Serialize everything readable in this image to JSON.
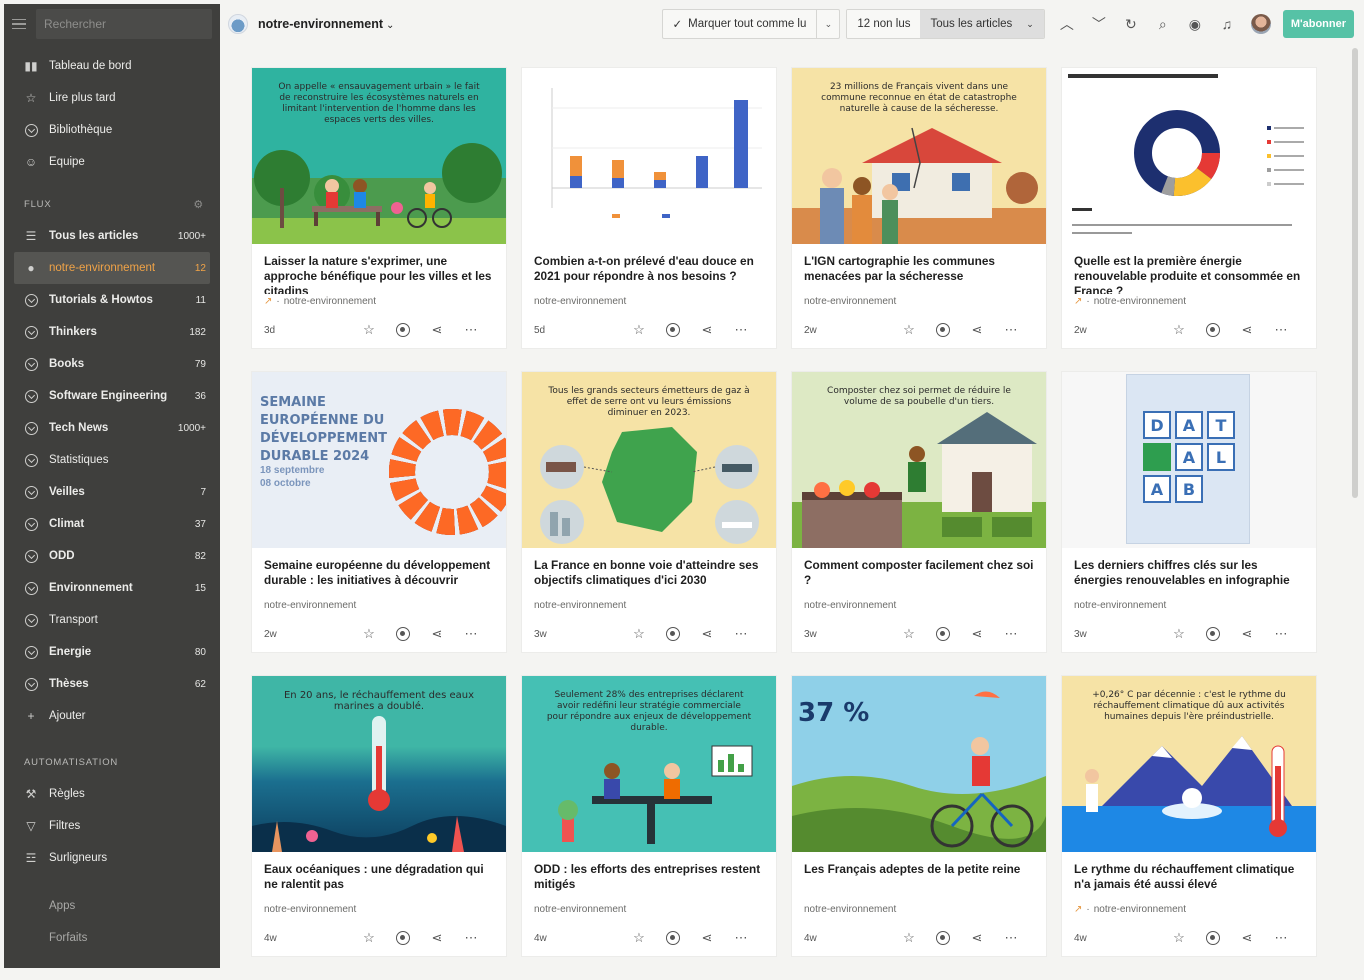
{
  "sidebar": {
    "search_placeholder": "Rechercher",
    "top_items": [
      {
        "label": "Tableau de bord",
        "icon": "bar-chart-icon"
      },
      {
        "label": "Lire plus tard",
        "icon": "star-icon"
      },
      {
        "label": "Bibliothèque",
        "icon": "check-circle-icon"
      },
      {
        "label": "Équipe",
        "icon": "team-icon"
      }
    ],
    "flux_title": "FLUX",
    "feeds": [
      {
        "label": "Tous les articles",
        "count": "1000+"
      },
      {
        "label": "notre-environnement",
        "count": "12"
      },
      {
        "label": "Tutorials & Howtos",
        "count": "11"
      },
      {
        "label": "Thinkers",
        "count": "182"
      },
      {
        "label": "Books",
        "count": "79"
      },
      {
        "label": "Software Engineering",
        "count": "36"
      },
      {
        "label": "Tech News",
        "count": "1000+"
      },
      {
        "label": "Statistiques",
        "count": ""
      },
      {
        "label": "Veilles",
        "count": "7"
      },
      {
        "label": "Climat",
        "count": "37"
      },
      {
        "label": "ODD",
        "count": "82"
      },
      {
        "label": "Environnement",
        "count": "15"
      },
      {
        "label": "Transport",
        "count": ""
      },
      {
        "label": "Energie",
        "count": "80"
      },
      {
        "label": "Thèses",
        "count": "62"
      },
      {
        "label": "Ajouter",
        "count": ""
      }
    ],
    "automation_title": "AUTOMATISATION",
    "automation": [
      {
        "label": "Règles"
      },
      {
        "label": "Filtres"
      },
      {
        "label": "Surligneurs"
      }
    ],
    "footer": [
      {
        "label": "Apps"
      },
      {
        "label": "Forfaits"
      }
    ]
  },
  "header": {
    "feed_name": "notre-environnement",
    "mark_all": "Marquer tout comme lu",
    "unread": "12 non lus",
    "filter": "Tous les articles",
    "subscribe": "M'abonner"
  },
  "thumb_texts": [
    "On appelle « ensauvagement urbain » le fait de reconstruire les écosystèmes naturels en limitant l'intervention de l'homme dans les espaces verts des villes.",
    "",
    "23 millions de Français vivent dans une commune reconnue en état de catastrophe naturelle à cause de la sécheresse.",
    "",
    "SEMAINE EUROPÉENNE DU DÉVELOPPEMENT DURABLE 2024",
    "Tous les grands secteurs émetteurs de gaz à effet de serre ont vu leurs émissions diminuer en 2023.",
    "Composter chez soi permet de réduire le volume de sa poubelle d'un tiers.",
    "",
    "En 20 ans, le réchauffement des eaux marines a doublé.",
    "Seulement 28% des entreprises déclarent avoir redéfini leur stratégie commerciale pour répondre aux enjeux de développement durable.",
    "37 %",
    "+0,26° C par décennie : c'est le rythme du réchauffement climatique dû aux activités humaines depuis l'ère préindustrielle."
  ],
  "sedd": {
    "dates1": "18 septembre",
    "dates2": "08 octobre"
  },
  "data_letters": [
    "D",
    "A",
    "T",
    "A",
    "L",
    "A",
    "B"
  ],
  "cards": [
    {
      "title": "Laisser la nature s'exprimer, une approche bénéfique pour les villes et les citadins",
      "source": "notre-environnement",
      "trend": true,
      "age": "3d"
    },
    {
      "title": "Combien a-t-on prélevé d'eau douce en 2021 pour répondre à nos besoins ?",
      "source": "notre-environnement",
      "trend": false,
      "age": "5d"
    },
    {
      "title": "L'IGN cartographie les communes menacées par la sécheresse",
      "source": "notre-environnement",
      "trend": false,
      "age": "2w"
    },
    {
      "title": "Quelle est la première énergie renouvelable produite et consommée en France ?",
      "source": "notre-environnement",
      "trend": true,
      "age": "2w"
    },
    {
      "title": "Semaine européenne du développement durable : les initiatives à découvrir",
      "source": "notre-environnement",
      "trend": false,
      "age": "2w"
    },
    {
      "title": "La France en bonne voie d'atteindre ses objectifs climatiques d'ici 2030",
      "source": "notre-environnement",
      "trend": false,
      "age": "3w"
    },
    {
      "title": "Comment composter facilement chez soi ?",
      "source": "notre-environnement",
      "trend": false,
      "age": "3w"
    },
    {
      "title": "Les derniers chiffres clés sur les énergies renouvelables en infographie",
      "source": "notre-environnement",
      "trend": false,
      "age": "3w"
    },
    {
      "title": "Eaux océaniques : une dégradation qui ne ralentit pas",
      "source": "notre-environnement",
      "trend": false,
      "age": "4w"
    },
    {
      "title": "ODD : les efforts des entreprises restent mitigés",
      "source": "notre-environnement",
      "trend": false,
      "age": "4w"
    },
    {
      "title": "Les Français adeptes de la petite reine",
      "source": "notre-environnement",
      "trend": false,
      "age": "4w"
    },
    {
      "title": "Le rythme du réchauffement climatique n'a jamais été aussi élevé",
      "source": "notre-environnement",
      "trend": true,
      "age": "4w"
    }
  ],
  "colors": {
    "accent": "#f0a347",
    "subscribe": "#56c2a6",
    "sidebar": "#3f3f3d"
  }
}
